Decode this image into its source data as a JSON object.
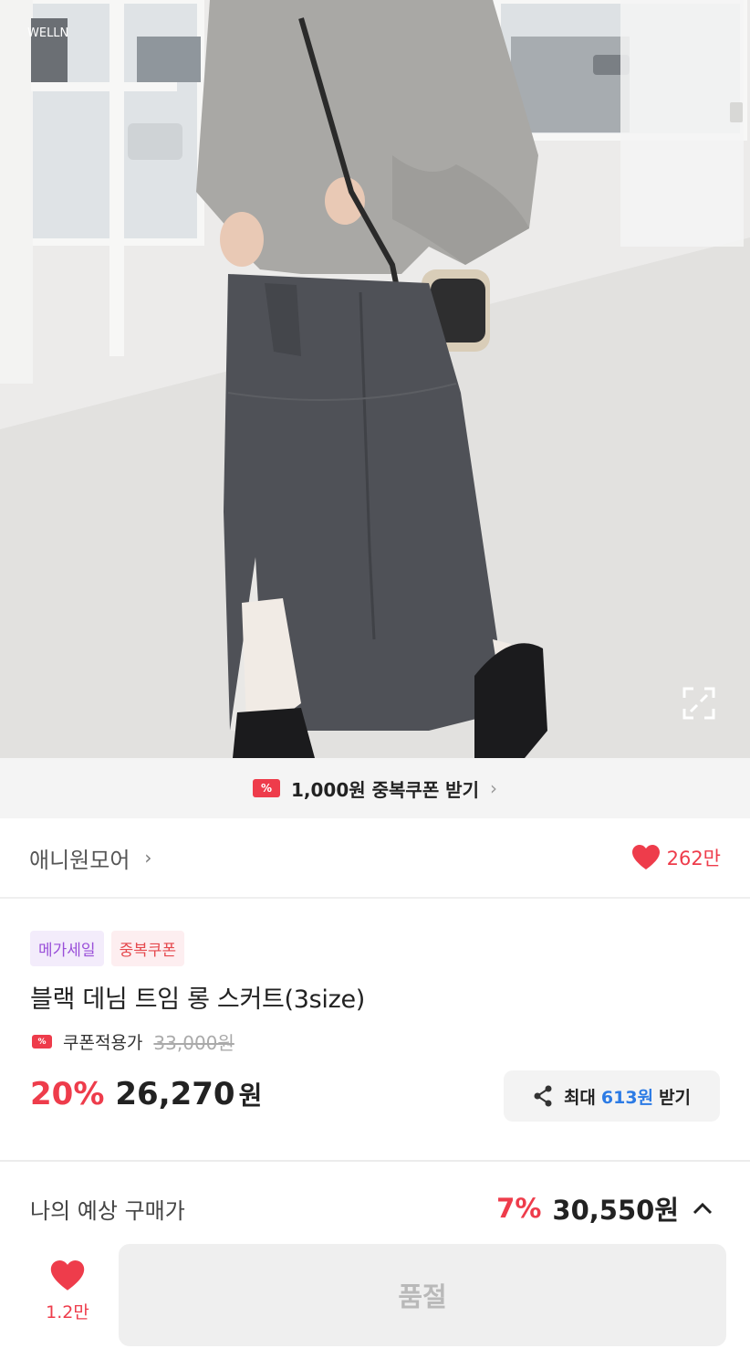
{
  "photo": {
    "sign_text": "WELLN",
    "colors": {
      "wall": "#ecebea",
      "floor": "#e3e2e0",
      "sweatshirt": "#a9a8a5",
      "denim": "#4f5157",
      "hair": "#1c1c1e"
    }
  },
  "coupon_banner": {
    "label": "1,000원 중복쿠폰 받기",
    "icon": "ticket-icon",
    "ticket_mark": "%"
  },
  "shop": {
    "name": "애니원모어",
    "chevron": "›",
    "likes": "262만"
  },
  "badges": [
    {
      "label": "메가세일"
    },
    {
      "label": "중복쿠폰"
    }
  ],
  "product": {
    "title": "블랙 데님 트임 롱 스커트(3size)",
    "coupon_price_label": "쿠폰적용가",
    "original_price": "33,000원",
    "discount_rate": "20%",
    "price": "26,270",
    "currency": "원"
  },
  "share": {
    "prefix": "최대",
    "amount": "613원",
    "suffix": "받기"
  },
  "expected": {
    "label": "나의 예상 구매가",
    "rate": "7%",
    "price": "30,550원"
  },
  "wishlist": {
    "count": "1.2만"
  },
  "buy_button": {
    "label": "품절"
  },
  "colors": {
    "accent": "#ee3c4b",
    "link_blue": "#2c7be5",
    "badge_purple": "#9a4fd9"
  }
}
